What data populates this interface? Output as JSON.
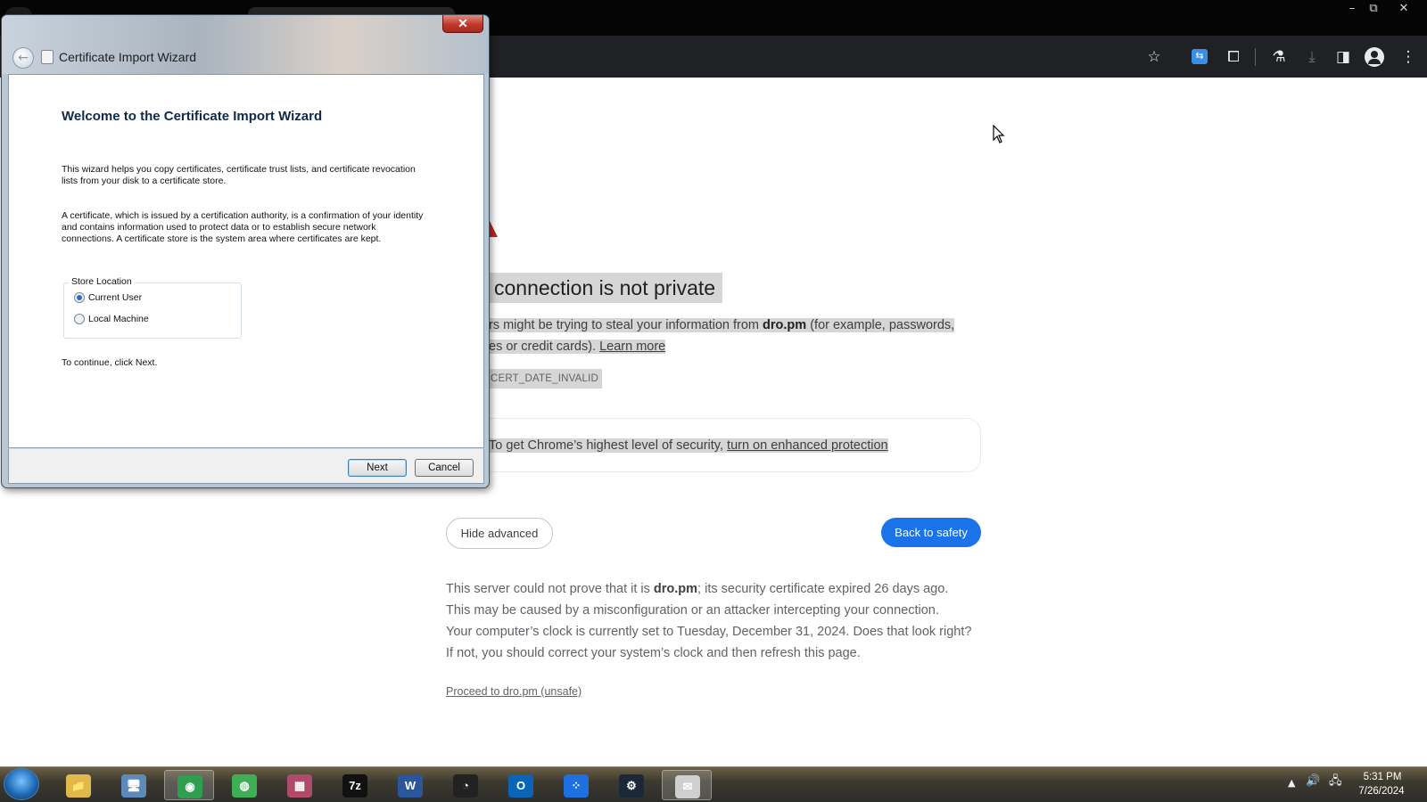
{
  "window_controls": {
    "minimize": "–",
    "restore": "⧉",
    "close": "✕"
  },
  "toolbar": {
    "icons": [
      "star-icon",
      "extension-blue-icon",
      "puzzle-icon",
      "labs-flask-icon",
      "download-icon",
      "side-panel-icon",
      "profile-icon",
      "menu-dots-icon"
    ],
    "glyphs": {
      "star": "☆",
      "puzzle": "⧠",
      "flask": "⚗",
      "download": "⤓",
      "sidepanel": "◨",
      "menu": "⋮"
    }
  },
  "page": {
    "heading": "connection is not private",
    "para_line1_pre": "rs might be trying to steal your information from ",
    "para_domain": "dro.pm",
    "para_line1_post": " (for example, passwords,",
    "para_line2_pre": "es or credit cards). ",
    "learn_more": "Learn more",
    "error_code": "CERT_DATE_INVALID",
    "protection_pre": "To get Chrome’s highest level of security, ",
    "protection_link": "turn on enhanced protection",
    "hide_advanced": "Hide advanced",
    "back_to_safety": "Back to safety",
    "detail_line1_pre": "This server could not prove that it is ",
    "detail_domain": "dro.pm",
    "detail_line1_post": "; its security certificate expired 26 days ago.",
    "detail_line2": "This may be caused by a misconfiguration or an attacker intercepting your connection.",
    "detail_line3": "Your computer’s clock is currently set to Tuesday, December 31, 2024. Does that look right?",
    "detail_line4": "If not, you should correct your system’s clock and then refresh this page.",
    "proceed_link": "Proceed to dro.pm (unsafe)"
  },
  "dialog": {
    "title": "Certificate Import Wizard",
    "close": "✕",
    "back": "←",
    "heading": "Welcome to the Certificate Import Wizard",
    "p1_line1": "This wizard helps you copy certificates, certificate trust lists, and certificate revocation",
    "p1_line2": "lists from your disk to a certificate store.",
    "p2_line1": "A certificate, which is issued by a certification authority, is a confirmation of your identity",
    "p2_line2": "and contains information used to protect data or to establish secure network",
    "p2_line3": "connections. A certificate store is the system area where certificates are kept.",
    "store_location_label": "Store Location",
    "options": [
      {
        "label": "Current User",
        "selected": true
      },
      {
        "label": "Local Machine",
        "selected": false
      }
    ],
    "continue_text": "To continue, click Next.",
    "next_button": "Next",
    "cancel_button": "Cancel"
  },
  "taskbar": {
    "apps": [
      {
        "name": "file-explorer",
        "glyph": "📁",
        "color": "#e0b94a"
      },
      {
        "name": "control-panel",
        "glyph": "🖥",
        "color": "#5d8ab8"
      },
      {
        "name": "chrome",
        "glyph": "◉",
        "color": "#2f9e4f",
        "active": true
      },
      {
        "name": "globe-browser",
        "glyph": "◍",
        "color": "#3fae55"
      },
      {
        "name": "winrar",
        "glyph": "▦",
        "color": "#b04a6b"
      },
      {
        "name": "7zip",
        "glyph": "7z",
        "color": "#111111"
      },
      {
        "name": "word",
        "glyph": "W",
        "color": "#2b579a"
      },
      {
        "name": "obs",
        "glyph": "◔",
        "color": "#222222"
      },
      {
        "name": "outlook",
        "glyph": "O",
        "color": "#0a64b8"
      },
      {
        "name": "blue-app",
        "glyph": "⁘",
        "color": "#1e6fe0"
      },
      {
        "name": "steam",
        "glyph": "⚙",
        "color": "#1b2838"
      },
      {
        "name": "certificate-manager",
        "glyph": "✉",
        "color": "#cfcfcf",
        "active": true
      }
    ],
    "tray": {
      "up_arrow": "▲",
      "volume": "🔊",
      "network": "🖧"
    },
    "time": "5:31 PM",
    "date": "7/26/2024"
  },
  "colors": {
    "accent": "#1a73e8",
    "warning": "#c5221f",
    "toolbar": "#202124"
  }
}
